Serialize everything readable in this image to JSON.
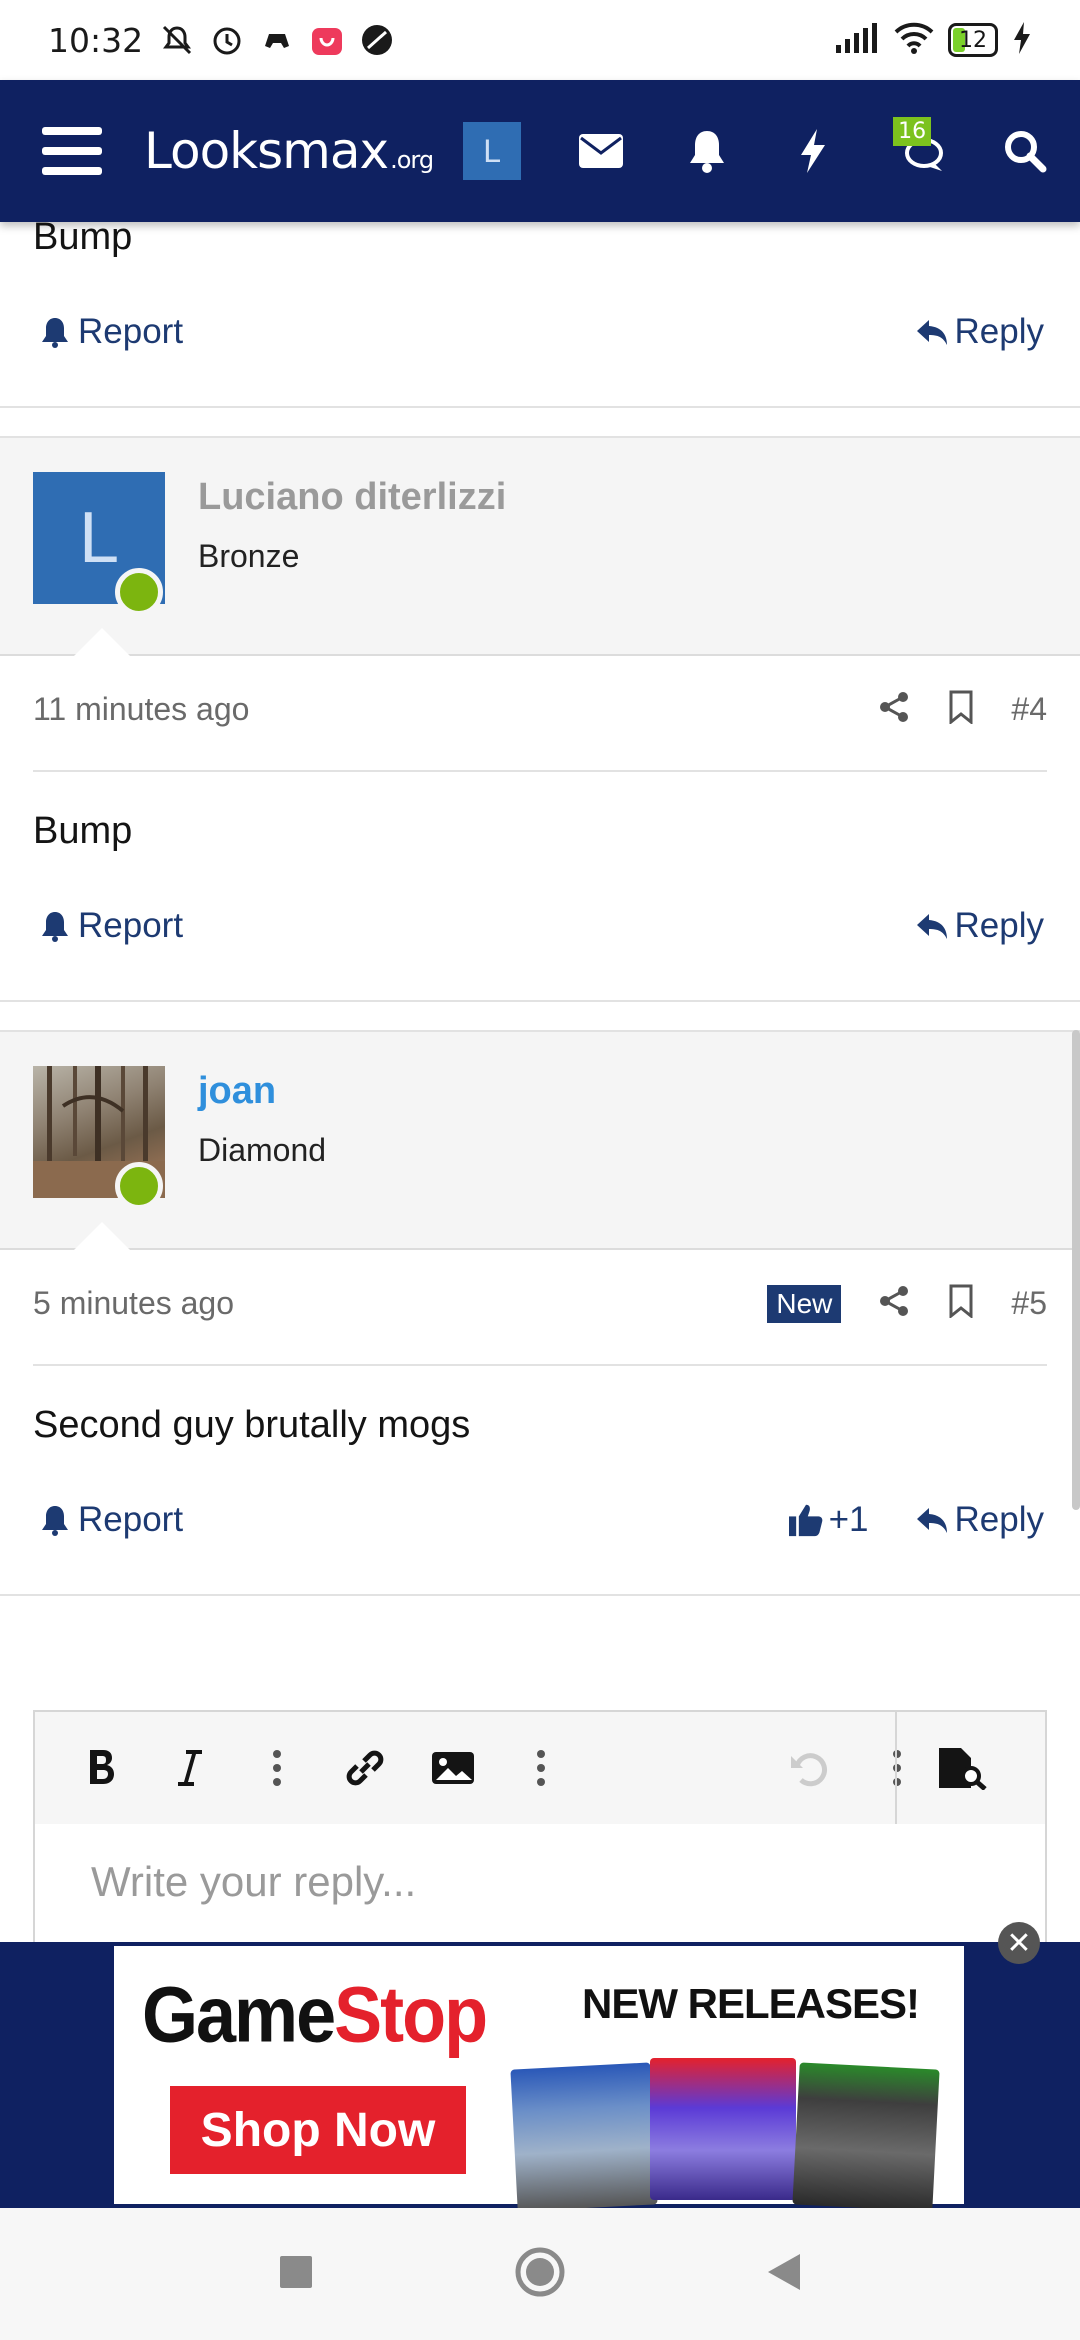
{
  "status_bar": {
    "time": "10:32",
    "battery": "12",
    "icons": [
      "mute-icon",
      "alarm-icon",
      "game-icon",
      "shop-app-icon",
      "app-icon"
    ],
    "right_icons": [
      "signal-icon",
      "wifi-icon",
      "battery-icon",
      "charging-icon"
    ]
  },
  "nav": {
    "logo_main": "Looksmax",
    "logo_suffix": ".org",
    "avatar_letter": "L",
    "conversations_badge": "16",
    "icons": [
      "menu-icon",
      "mail-icon",
      "bell-icon",
      "bolt-icon",
      "chat-icon",
      "search-icon"
    ]
  },
  "posts": [
    {
      "body": "Bump",
      "report_label": "Report",
      "reply_label": "Reply"
    },
    {
      "author": "Luciano diterlizzi",
      "rank": "Bronze",
      "avatar_letter": "L",
      "time": "11 minutes ago",
      "number": "#4",
      "body": "Bump",
      "report_label": "Report",
      "reply_label": "Reply"
    },
    {
      "author": "joan",
      "rank": "Diamond",
      "time": "5 minutes ago",
      "new_label": "New",
      "number": "#5",
      "body": "Second guy brutally mogs",
      "report_label": "Report",
      "like_count": "+1",
      "reply_label": "Reply"
    }
  ],
  "editor": {
    "placeholder": "Write your reply..."
  },
  "ad": {
    "brand_part1": "Game",
    "brand_part2": "Stop",
    "cta": "Shop Now",
    "headline": "NEW RELEASES!",
    "close_icon": "close-icon"
  },
  "colors": {
    "nav_bg": "#0f2161",
    "link": "#1d3a72",
    "online": "#7cb50f",
    "username_blue": "#2f8fdc",
    "username_gray": "#9a9a9a",
    "badge_green": "#7cc21e",
    "gamestop_red": "#e4212c"
  }
}
